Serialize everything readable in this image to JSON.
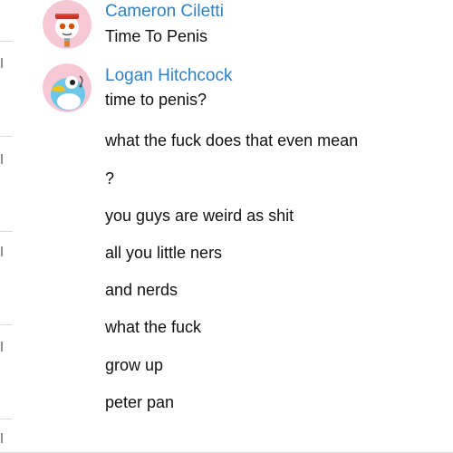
{
  "conversation": {
    "groups": [
      {
        "sender": "Cameron Ciletti",
        "avatar_icon": "cartoon-character-avatar-icon",
        "messages": [
          "Time To Penis"
        ]
      },
      {
        "sender": "Logan Hitchcock",
        "avatar_icon": "cartoon-bird-avatar-icon",
        "messages": [
          "time to penis?",
          "what the fuck does that even mean",
          "?",
          "you guys are weird as shit",
          "all you little ners",
          "and nerds",
          "what the fuck",
          "grow up",
          "peter pan"
        ]
      }
    ]
  },
  "colors": {
    "sender_name": "#2f80c4",
    "message_text": "#111111",
    "avatar_1_background": "#f6c8d5",
    "avatar_2_background": "#f6c8d5"
  }
}
